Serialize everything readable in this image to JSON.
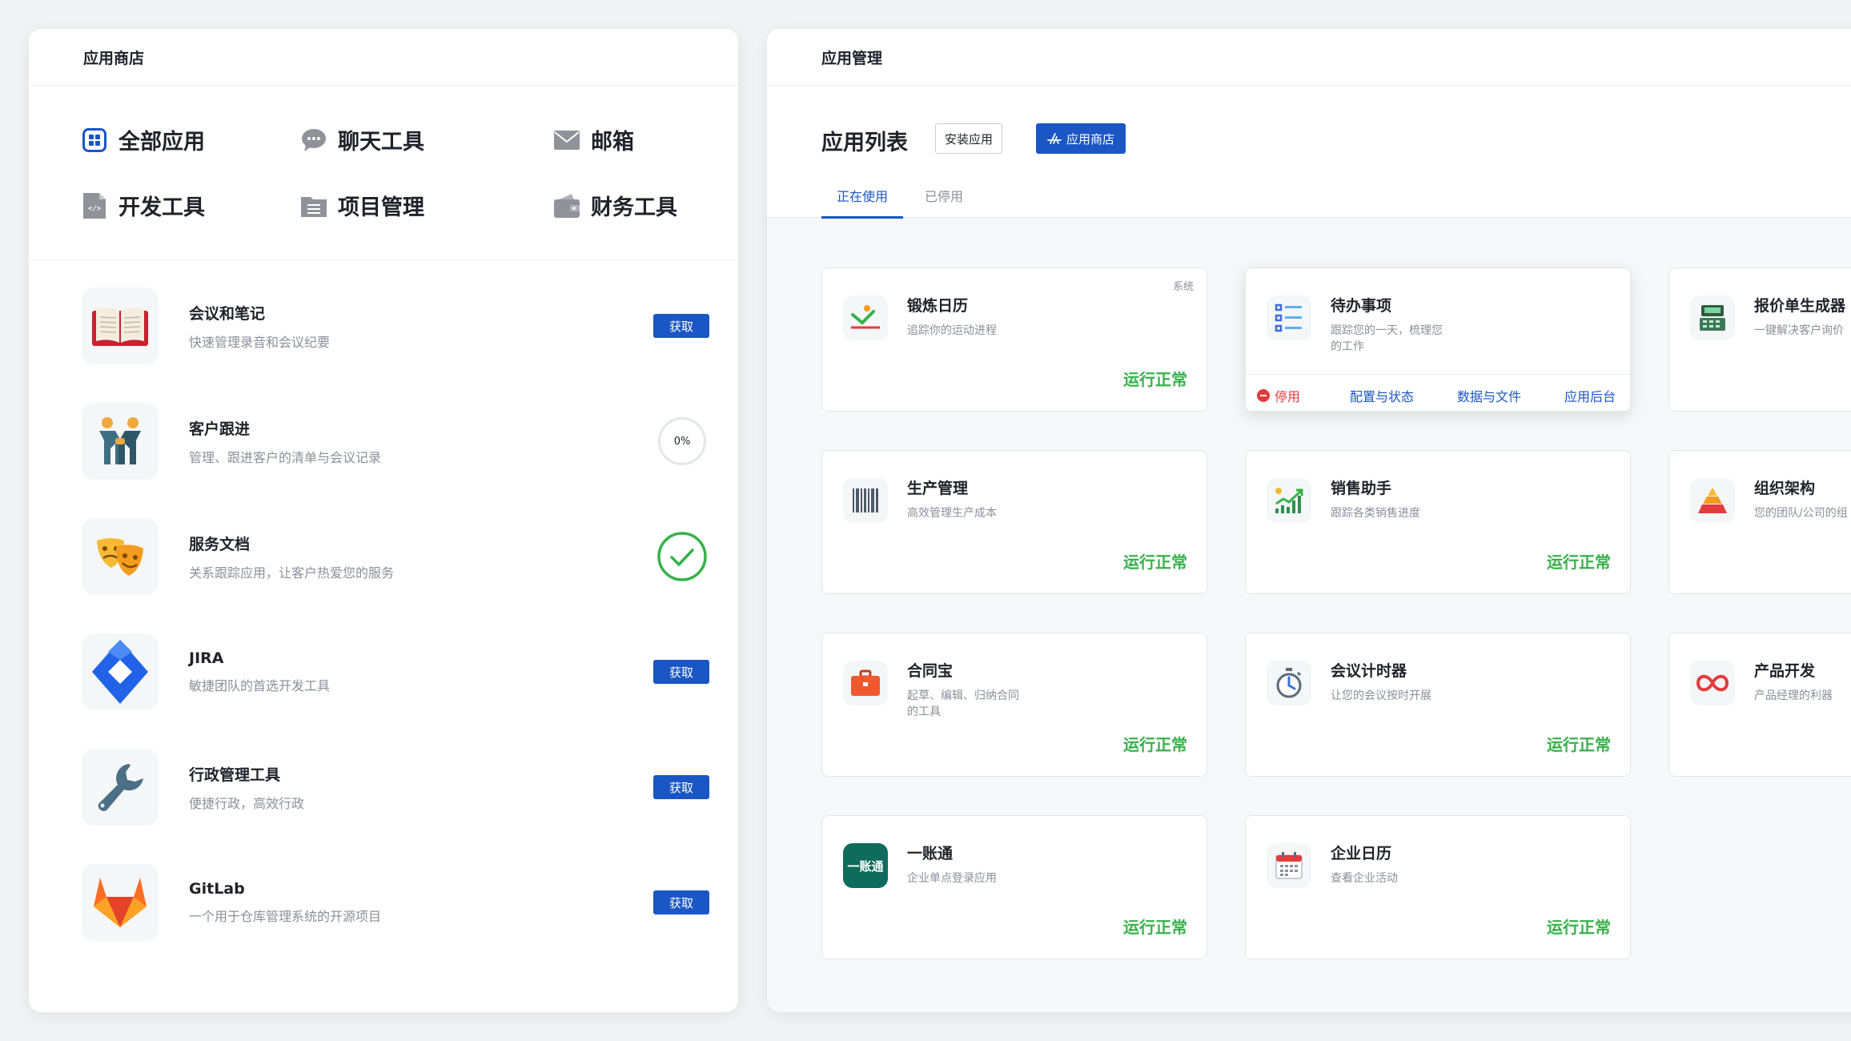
{
  "store": {
    "header": "应用商店",
    "categories": [
      {
        "label": "全部应用",
        "icon": "grid-icon"
      },
      {
        "label": "聊天工具",
        "icon": "chat-icon"
      },
      {
        "label": "邮箱",
        "icon": "mail-icon"
      },
      {
        "label": "开发工具",
        "icon": "code-file-icon"
      },
      {
        "label": "项目管理",
        "icon": "folder-icon"
      },
      {
        "label": "财务工具",
        "icon": "wallet-icon"
      }
    ],
    "apps": [
      {
        "name": "会议和笔记",
        "desc": "快速管理录音和会议纪要",
        "action": "获取",
        "icon": "book-icon"
      },
      {
        "name": "客户跟进",
        "desc": "管理、跟进客户的清单与会议记录",
        "progress": "0%",
        "icon": "handshake-icon"
      },
      {
        "name": "服务文档",
        "desc": "关系跟踪应用，让客户热爱您的服务",
        "state": "installed",
        "icon": "theater-masks-icon"
      },
      {
        "name": "JIRA",
        "desc": "敏捷团队的首选开发工具",
        "action": "获取",
        "icon": "jira-logo-icon"
      },
      {
        "name": "行政管理工具",
        "desc": "便捷行政，高效行政",
        "action": "获取",
        "icon": "wrench-icon"
      },
      {
        "name": "GitLab",
        "desc": "一个用于仓库管理系统的开源项目",
        "action": "获取",
        "icon": "gitlab-logo-icon"
      }
    ]
  },
  "manage": {
    "header": "应用管理",
    "list_title": "应用列表",
    "install_label": "安装应用",
    "store_label": "应用商店",
    "tabs": [
      "正在使用",
      "已停用"
    ],
    "status_ok": "运行正常",
    "system_tag": "系统",
    "actions": {
      "disable": "停用",
      "config": "配置与状态",
      "data": "数据与文件",
      "admin": "应用后台"
    },
    "cards": [
      {
        "name": "锻炼日历",
        "desc": "追踪你的运动进程",
        "icon": "exercise-icon"
      },
      {
        "name": "待办事项",
        "desc": "跟踪您的一天，梳理您的工作",
        "icon": "checklist-icon"
      },
      {
        "name": "报价单生成器",
        "desc": "一键解决客户询价",
        "icon": "cash-register-icon"
      },
      {
        "name": "生产管理",
        "desc": "高效管理生产成本",
        "icon": "barcode-icon"
      },
      {
        "name": "销售助手",
        "desc": "跟踪各类销售进度",
        "icon": "growth-chart-icon"
      },
      {
        "name": "组织架构",
        "desc": "您的团队/公司的组",
        "icon": "pyramid-icon"
      },
      {
        "name": "合同宝",
        "desc": "起草、编辑、归纳合同的工具",
        "icon": "briefcase-icon"
      },
      {
        "name": "会议计时器",
        "desc": "让您的会议按时开展",
        "icon": "stopwatch-icon"
      },
      {
        "name": "产品开发",
        "desc": "产品经理的利器",
        "icon": "infinity-icon"
      },
      {
        "name": "一账通",
        "desc": "企业单点登录应用",
        "logo_text": "一账通",
        "icon": "yizhangtong-logo-icon"
      },
      {
        "name": "企业日历",
        "desc": "查看企业活动",
        "icon": "calendar-icon"
      }
    ]
  },
  "colors": {
    "primary": "#1a56c4",
    "success": "#36b24a",
    "danger": "#e23c3c",
    "muted": "#8a8f99"
  }
}
